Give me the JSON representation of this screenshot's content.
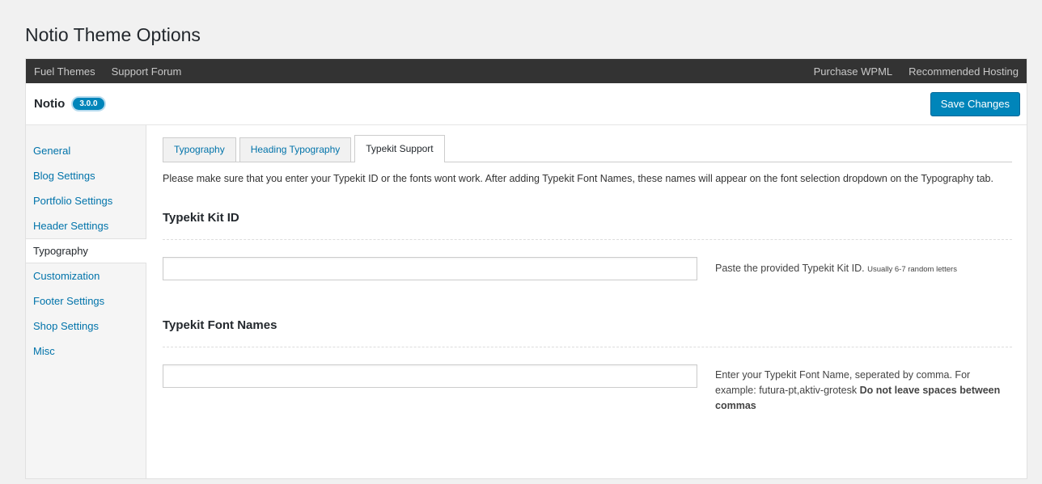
{
  "page": {
    "title": "Notio Theme Options"
  },
  "topbar": {
    "left_links": [
      "Fuel Themes",
      "Support Forum"
    ],
    "right_links": [
      "Purchase WPML",
      "Recommended Hosting"
    ]
  },
  "header": {
    "brand": "Notio",
    "version": "3.0.0",
    "save_label": "Save Changes"
  },
  "sidebar": {
    "items": [
      {
        "label": "General"
      },
      {
        "label": "Blog Settings"
      },
      {
        "label": "Portfolio Settings"
      },
      {
        "label": "Header Settings"
      },
      {
        "label": "Typography",
        "active": true
      },
      {
        "label": "Customization"
      },
      {
        "label": "Footer Settings"
      },
      {
        "label": "Shop Settings"
      },
      {
        "label": "Misc"
      }
    ]
  },
  "tabs": [
    {
      "label": "Typography"
    },
    {
      "label": "Heading Typography"
    },
    {
      "label": "Typekit Support",
      "active": true
    }
  ],
  "main": {
    "intro": "Please make sure that you enter your Typekit ID or the fonts wont work. After adding Typekit Font Names, these names will appear on the font selection dropdown on the Typography tab.",
    "kit_id": {
      "title": "Typekit Kit ID",
      "value": "",
      "desc": "Paste the provided Typekit Kit ID.",
      "desc_small": "Usually 6-7 random letters"
    },
    "font_names": {
      "title": "Typekit Font Names",
      "value": "",
      "desc": "Enter your Typekit Font Name, seperated by comma. For example: futura-pt,aktiv-grotesk",
      "desc_bold": "Do not leave spaces between commas"
    }
  },
  "colors": {
    "accent": "#0085ba",
    "link": "#0073aa",
    "topbar_bg": "#333333"
  }
}
